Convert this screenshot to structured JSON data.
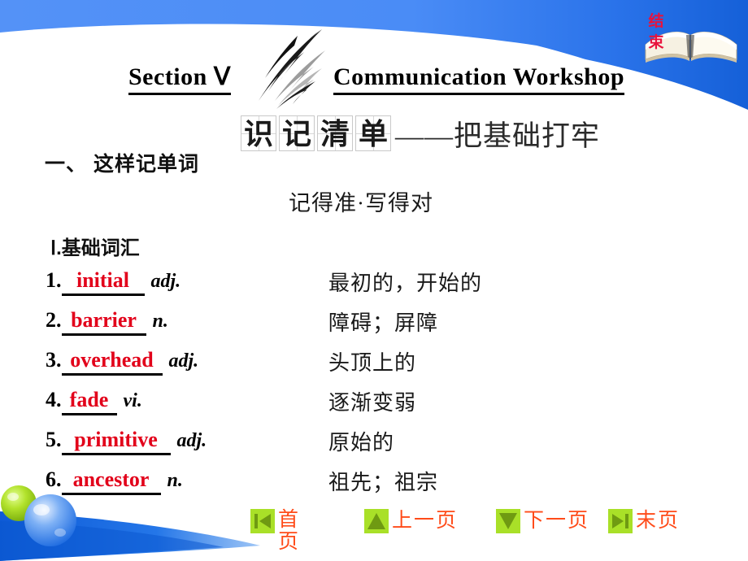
{
  "header": {
    "section_label": "Section Ⅴ",
    "workshop_label": "Communication Workshop",
    "end_badge_text": "结束",
    "brush_icon": "brush-stroke-icon",
    "book_icon": "open-book-icon"
  },
  "heading": {
    "grid_chars": [
      "识",
      "记",
      "清",
      "单"
    ],
    "tail": "——把基础打牢"
  },
  "sections": {
    "one": "一、 这样记单词",
    "subtitle": "记得准·写得对",
    "basic": "Ⅰ.基础词汇"
  },
  "vocab": [
    {
      "num": "1.",
      "word": "initial",
      "pos": "adj.",
      "meaning": "最初的，开始的",
      "blank_width": 96
    },
    {
      "num": "2.",
      "word": "barrier",
      "pos": "n.",
      "meaning": "障碍；屏障",
      "blank_width": 98
    },
    {
      "num": "3.",
      "word": "overhead",
      "pos": "adj.",
      "meaning": "头顶上的",
      "blank_width": 118
    },
    {
      "num": "4.",
      "word": "fade",
      "pos": "vi.",
      "meaning": "逐渐变弱",
      "blank_width": 62
    },
    {
      "num": "5.",
      "word": "primitive",
      "pos": "adj.",
      "meaning": "原始的",
      "blank_width": 128
    },
    {
      "num": "6.",
      "word": "ancestor",
      "pos": "n.",
      "meaning": "祖先；祖宗",
      "blank_width": 116
    }
  ],
  "nav": [
    {
      "label": "首页",
      "icon": "first-page-icon"
    },
    {
      "label": "上一页",
      "icon": "up-triangle-icon"
    },
    {
      "label": "下一页",
      "icon": "down-triangle-icon"
    },
    {
      "label": "末页",
      "icon": "last-page-icon"
    }
  ],
  "colors": {
    "header_blue": "#5492f7",
    "header_blue_dark": "#1560d8",
    "footer_blue": "#1565e0",
    "nav_green": "#a9e028",
    "nav_text_red": "#ff4b19",
    "word_red": "#e2001a",
    "badge_red": "#e8123c"
  }
}
